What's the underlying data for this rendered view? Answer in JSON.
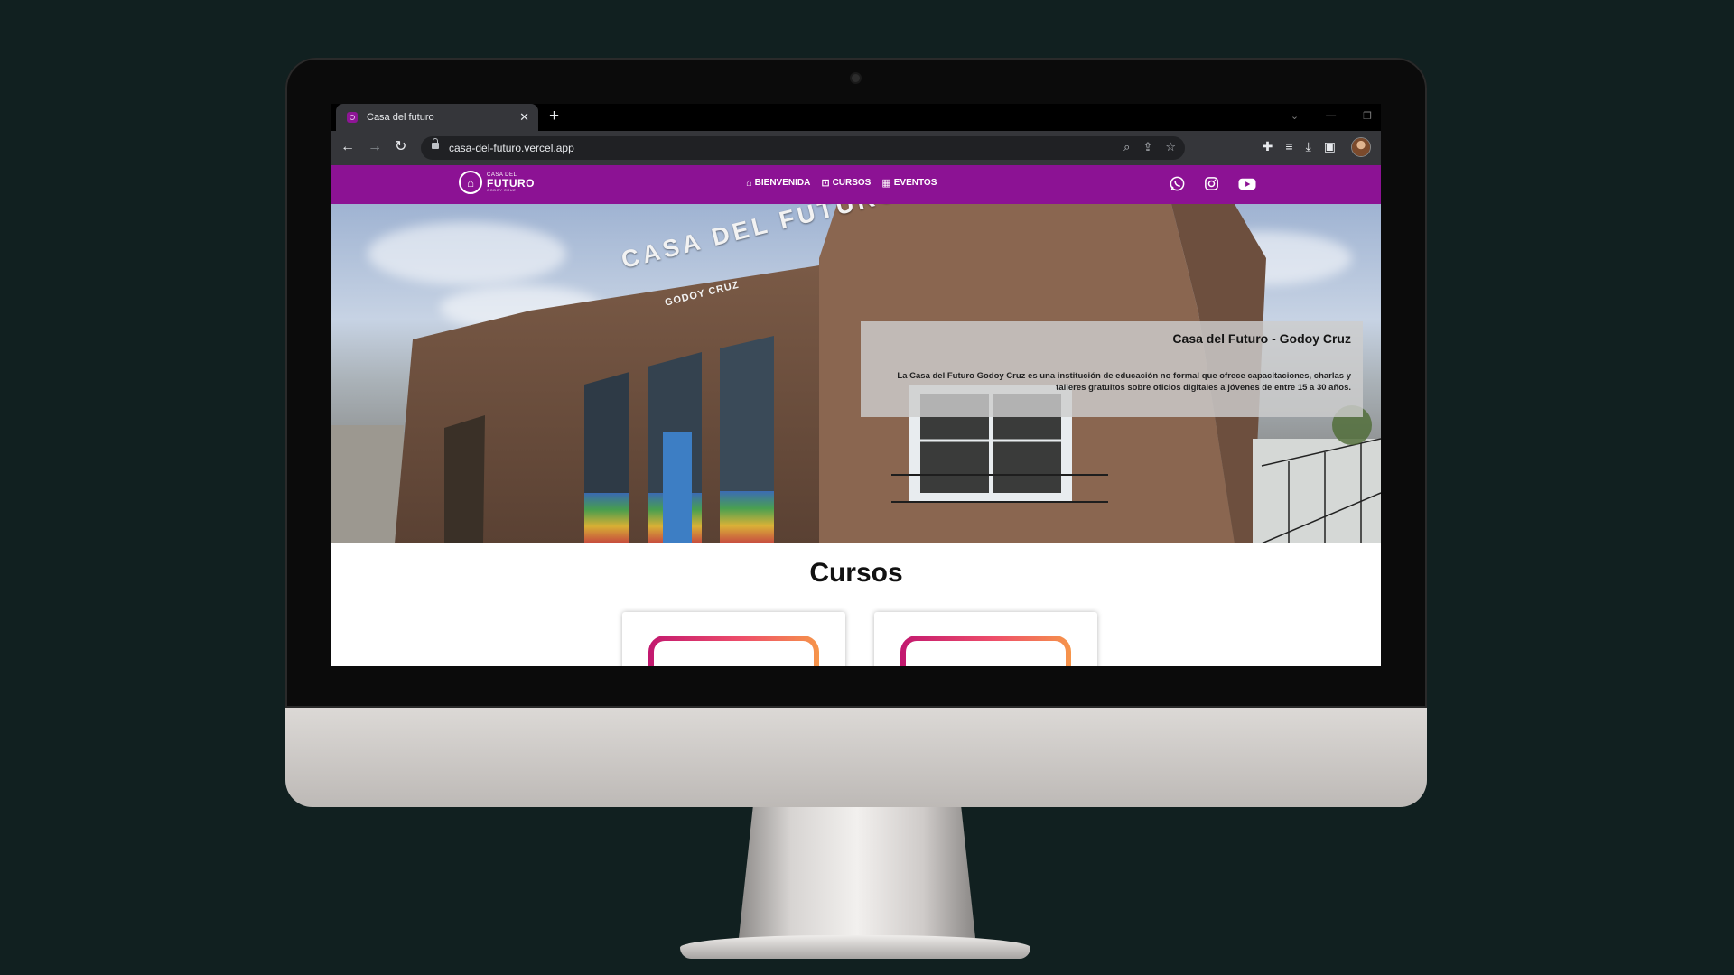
{
  "browser": {
    "tab_title": "Casa del futuro",
    "tab_close": "✕",
    "new_tab": "+",
    "url": "casa-del-futuro.vercel.app",
    "icons": [
      "back-icon",
      "forward-icon",
      "reload-icon",
      "lock-icon",
      "zoom-icon",
      "share-icon",
      "star-icon",
      "extensions-icon",
      "reading-list-icon",
      "download-icon",
      "side-panel-icon",
      "profile-avatar"
    ]
  },
  "site": {
    "logo": {
      "small": "CASA DEL",
      "big": "FUTURO",
      "tiny": "GODOY CRUZ"
    },
    "menu": [
      {
        "label": "BIENVENIDA",
        "icon": "home-icon"
      },
      {
        "label": "CURSOS",
        "icon": "chalkboard-icon"
      },
      {
        "label": "EVENTOS",
        "icon": "calendar-icon"
      }
    ],
    "socials": [
      "whatsapp-icon",
      "instagram-icon",
      "youtube-icon"
    ],
    "colors": {
      "nav": "#8c1294",
      "card_gradient": [
        "#c2186f",
        "#f6954a"
      ]
    },
    "hero": {
      "sign": "CASA DEL FUTURO",
      "sign_sub": "GODOY CRUZ",
      "title": "Casa del Futuro - Godoy Cruz",
      "description": "La Casa del Futuro Godoy Cruz es una institución de educación no formal que ofrece capacitaciones, charlas y talleres gratuitos sobre oficios digitales a jóvenes de entre 15 a 30 años."
    },
    "courses_title": "Cursos"
  }
}
